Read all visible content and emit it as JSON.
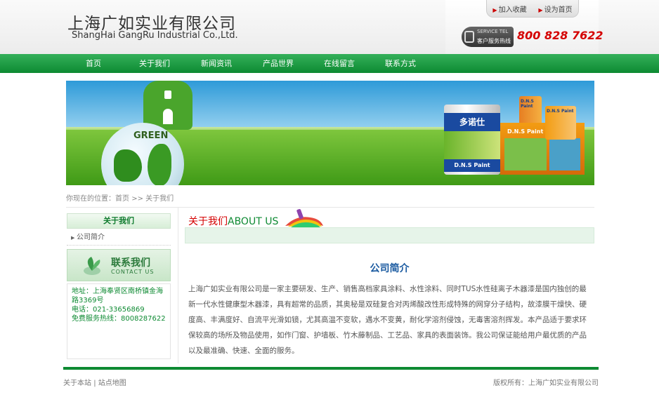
{
  "header": {
    "logo_cn": "上海广如实业有限公司",
    "logo_en": "ShangHai GangRu Industrial Co.,Ltd.",
    "top_links": [
      "加入收藏",
      "设为首页"
    ],
    "service_en": "SERVICE TEL",
    "service_cn": "客户服务热线",
    "phone": "800 828 7622"
  },
  "nav": {
    "items": [
      "首页",
      "关于我们",
      "新闻资讯",
      "产品世界",
      "在线留言",
      "联系方式"
    ]
  },
  "banner": {
    "globe_text": "GREEN",
    "can_brand": "多诺仕",
    "can_footer": "D.N.S Paint",
    "box_label": "D.N.S Paint",
    "can_small": "D.N.S Paint"
  },
  "breadcrumb": {
    "prefix": "你现在的位置：",
    "home": "首页",
    "sep": ">>",
    "current": "关于我们"
  },
  "sidebar": {
    "title": "关于我们",
    "items": [
      "公司简介"
    ],
    "contact_cn": "联系我们",
    "contact_en": "CONTACT US",
    "address": "地址：上海奉贤区南桥镇金海路3369号",
    "tel": "电话：021-33656869",
    "hotline": "免费服务热线：8008287622"
  },
  "main": {
    "title_cn": "关于我们",
    "title_en": "ABOUT US",
    "section_title": "公司简介",
    "body": "上海广如实业有限公司是一家主要研发、生产、销售高档家具涂料、水性涂料、同时TUS水性硅离子木器漆是国内独创的最新一代水性健康型木器漆，具有超常的品质，其奥秘是双硅复合对丙烯酸改性形成特殊的网穿分子结构，故漆膜干燥快、硬度高、丰满度好、自流平光滑如镜，尤其高温不变软，遇水不变黄，耐化学溶剂侵蚀，无毒害溶剂挥发。本产品适于要求环保较高的场所及物品使用，如作门窗、护墙板、竹木藤制品、工艺品、家具的表面装饰。我公司保证能给用户最优质的产品以及最准确、快速、全面的服务。"
  },
  "footer": {
    "about": "关于本站",
    "sep": "|",
    "sitemap": "站点地图",
    "copyright": "版权所有：上海广如实业有限公司"
  }
}
